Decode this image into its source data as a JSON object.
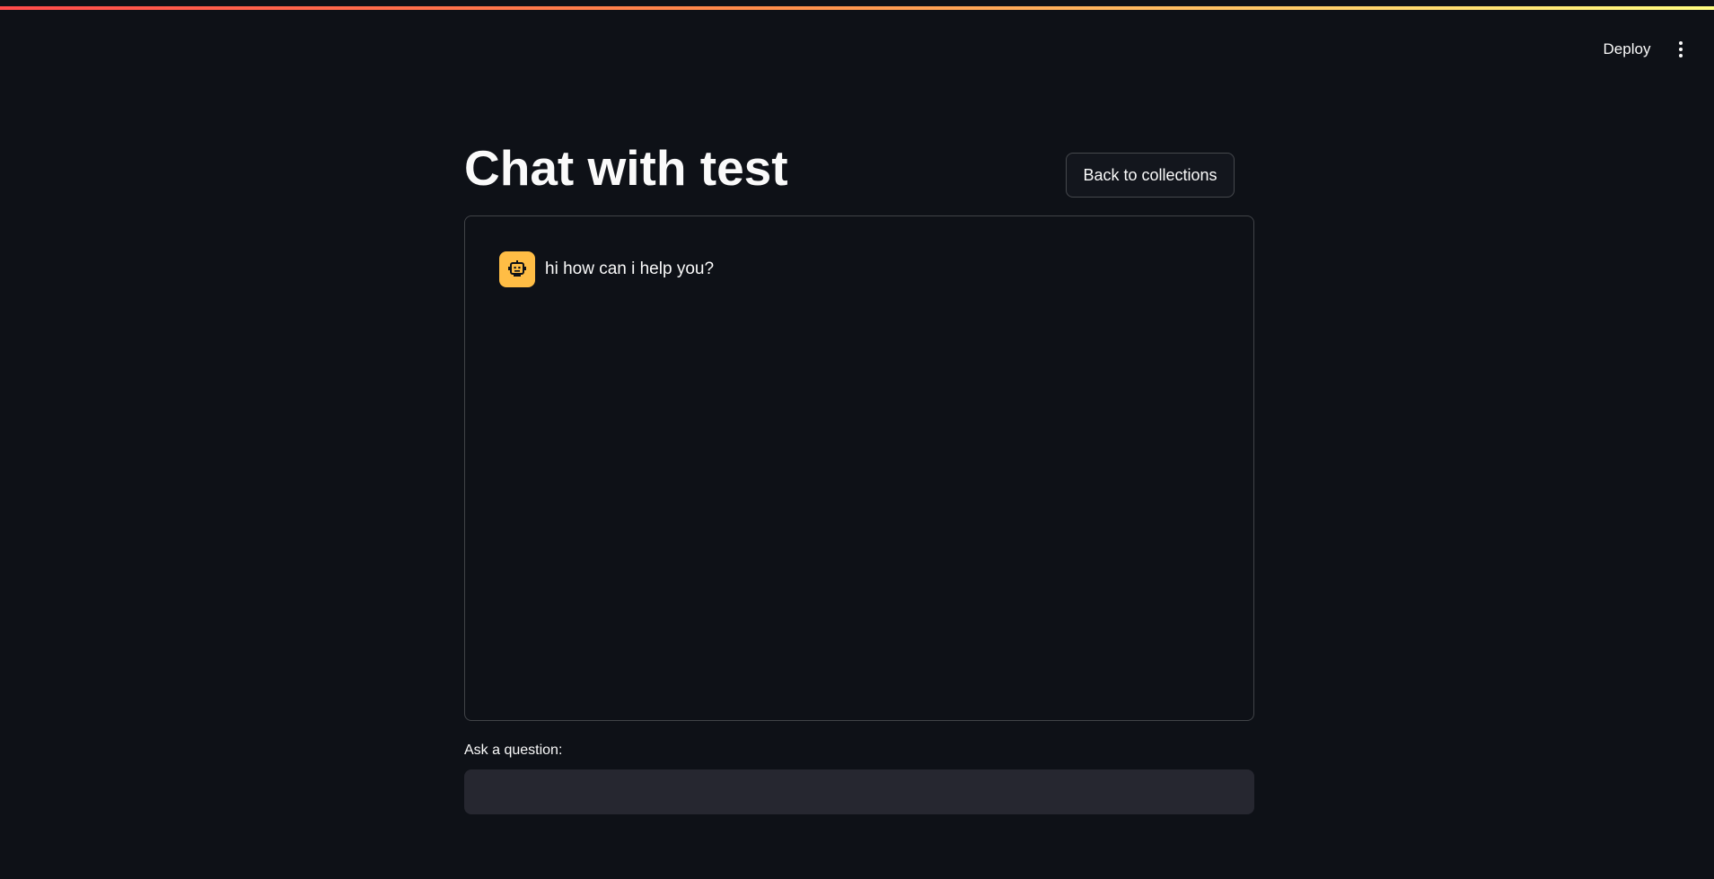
{
  "header": {
    "deploy_label": "Deploy",
    "menu_icon": "more-vertical-icon"
  },
  "page": {
    "title": "Chat with test",
    "back_button_label": "Back to collections"
  },
  "chat": {
    "messages": [
      {
        "role": "assistant",
        "avatar_icon": "robot-icon",
        "text": "hi how can i help you?"
      }
    ]
  },
  "question_input": {
    "label": "Ask a question:",
    "value": "",
    "placeholder": ""
  },
  "colors": {
    "background": "#0e1117",
    "avatar": "#ffbd45",
    "input_background": "#262730",
    "stripe_start": "#ff4b4b",
    "stripe_end": "#fffd80"
  }
}
